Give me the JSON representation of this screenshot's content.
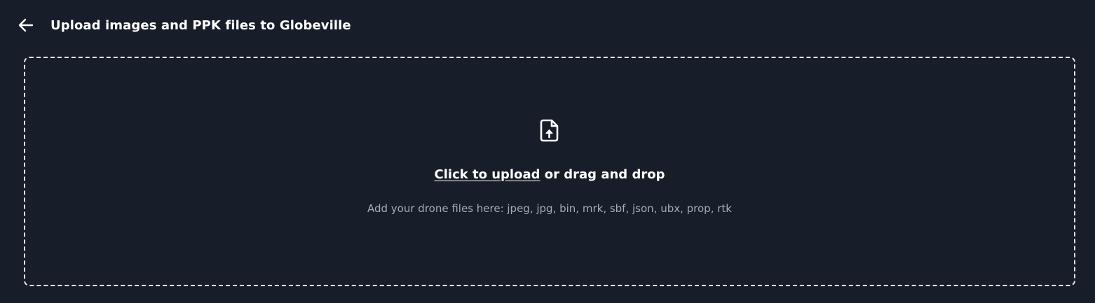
{
  "header": {
    "back_icon": "arrow-left-icon",
    "title": "Upload images and PPK files to Globeville"
  },
  "dropzone": {
    "icon": "file-upload-icon",
    "click_label": "Click to upload",
    "drag_label": " or drag and drop",
    "hint": "Add your drone files here: jpeg, jpg, bin, mrk, sbf, json, ubx, prop, rtk"
  },
  "colors": {
    "background": "#171d29",
    "text": "#ffffff",
    "muted_text": "#a5abb6",
    "dropzone_border": "#e6e8ec"
  }
}
